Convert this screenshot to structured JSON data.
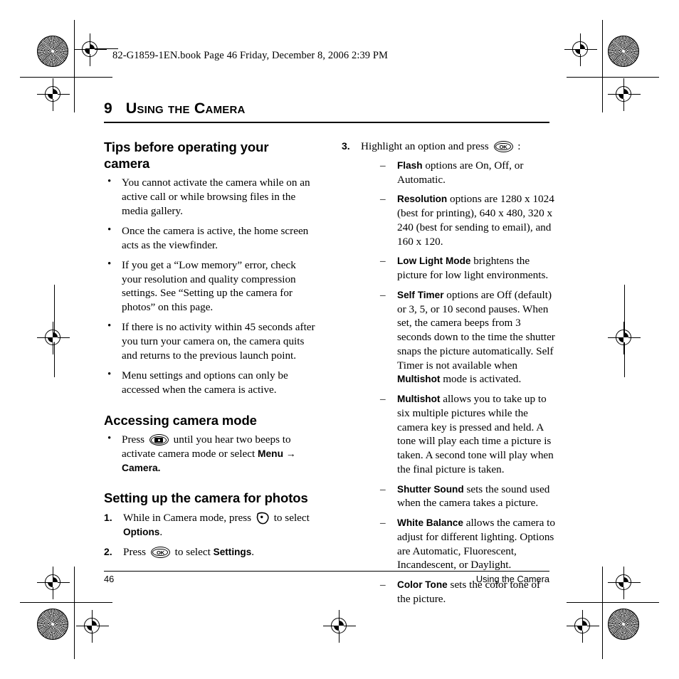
{
  "slug": {
    "text": "82-G1859-1EN.book  Page 46  Friday, December 8, 2006  2:39 PM"
  },
  "chapter": {
    "number": "9",
    "title": "Using the Camera"
  },
  "left_column": {
    "section1": {
      "heading": "Tips before operating your camera",
      "bullets": [
        "You cannot activate the camera while on an active call or while browsing files in the media gallery.",
        "Once the camera is active, the home screen acts as the viewfinder.",
        "If you get a “Low memory” error, check your resolution and quality compression settings. See “Setting up the camera for photos” on this page.",
        "If there is no activity within 45 seconds after you turn your camera on, the camera quits and returns to the previous launch point.",
        "Menu settings and options can only be accessed when the camera is active."
      ]
    },
    "section2": {
      "heading": "Accessing camera mode",
      "bullet_pre": "Press",
      "bullet_post": "until you hear two beeps to activate camera mode or select",
      "nav_path": "Menu → Camera.",
      "icon": "camera-key-icon"
    },
    "section3": {
      "heading": "Setting up the camera for photos",
      "steps": [
        {
          "num": "1.",
          "pre": "While in Camera mode, press",
          "icon": "soft-key-icon",
          "mid": "to select",
          "bold": "Options",
          "post": "."
        },
        {
          "num": "2.",
          "pre": "Press",
          "icon": "ok-key-icon",
          "mid": "to select",
          "bold": "Settings",
          "post": "."
        }
      ]
    }
  },
  "right_column": {
    "step": {
      "num": "3.",
      "pre": "Highlight an option and press",
      "icon": "ok-key-icon",
      "post": ":"
    },
    "options": [
      {
        "term": "Flash",
        "text": " options are On, Off, or Automatic."
      },
      {
        "term": "Resolution",
        "text": " options are 1280 x 1024 (best for printing), 640 x 480, 320 x 240 (best for sending to email), and 160 x 120."
      },
      {
        "term": "Low Light Mode",
        "text": " brightens the picture for low light environments."
      },
      {
        "term": "Self Timer",
        "text": " options are Off (default) or 3, 5, or 10 second pauses. When set, the camera beeps from 3 seconds down to the time the shutter snaps the picture automatically. Self Timer is not available when ",
        "term2": "Multishot",
        "text2": " mode is activated."
      },
      {
        "term": "Multishot",
        "text": " allows you to take up to six multiple pictures while the camera key is pressed and held. A tone will play each time a picture is taken. A second tone will play when the final picture is taken."
      },
      {
        "term": "Shutter Sound",
        "text": " sets the sound used when the camera takes a picture."
      },
      {
        "term": "White Balance",
        "text": " allows the camera to adjust for different lighting. Options are Automatic, Fluorescent, Incandescent, or Daylight."
      },
      {
        "term": "Color Tone",
        "text": " sets the color tone of the picture."
      }
    ]
  },
  "footer": {
    "page_number": "46",
    "running_head": "Using the Camera"
  },
  "colors": {
    "ink": "#000000",
    "paper": "#ffffff"
  }
}
